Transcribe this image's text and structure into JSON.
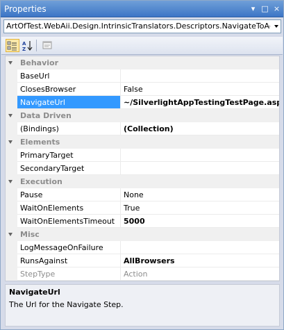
{
  "window": {
    "title": "Properties",
    "buttons": [
      "▾",
      "□",
      "×"
    ]
  },
  "object_selector": {
    "value": "ArtOfTest.WebAii.Design.IntrinsicTranslators.Descriptors.NavigateToAc"
  },
  "toolbar": {
    "buttons": [
      {
        "name": "categorized-button",
        "icon": "categorized-icon",
        "active": true
      },
      {
        "name": "alphabetical-button",
        "icon": "alphabetical-icon",
        "label": "A Z",
        "active": false
      },
      {
        "name": "property-pages-button",
        "icon": "property-pages-icon",
        "active": false
      }
    ]
  },
  "grid": {
    "categories": [
      {
        "label": "Behavior",
        "properties": [
          {
            "name": "BaseUrl",
            "value": ""
          },
          {
            "name": "ClosesBrowser",
            "value": "False"
          },
          {
            "name": "NavigateUrl",
            "value": "~/SilverlightAppTestingTestPage.aspx"
          }
        ]
      },
      {
        "label": "Data Driven",
        "properties": [
          {
            "name": "(Bindings)",
            "value": "(Collection)"
          }
        ]
      },
      {
        "label": "Elements",
        "properties": [
          {
            "name": "PrimaryTarget",
            "value": ""
          },
          {
            "name": "SecondaryTarget",
            "value": ""
          }
        ]
      },
      {
        "label": "Execution",
        "properties": [
          {
            "name": "Pause",
            "value": "None"
          },
          {
            "name": "WaitOnElements",
            "value": "True"
          },
          {
            "name": "WaitOnElementsTimeout",
            "value": "5000"
          }
        ]
      },
      {
        "label": "Misc",
        "properties": [
          {
            "name": "LogMessageOnFailure",
            "value": ""
          },
          {
            "name": "RunsAgainst",
            "value": "AllBrowsers"
          },
          {
            "name": "StepType",
            "value": "Action"
          }
        ]
      }
    ]
  },
  "description": {
    "title": "NavigateUrl",
    "text": "The Url for the Navigate Step."
  }
}
